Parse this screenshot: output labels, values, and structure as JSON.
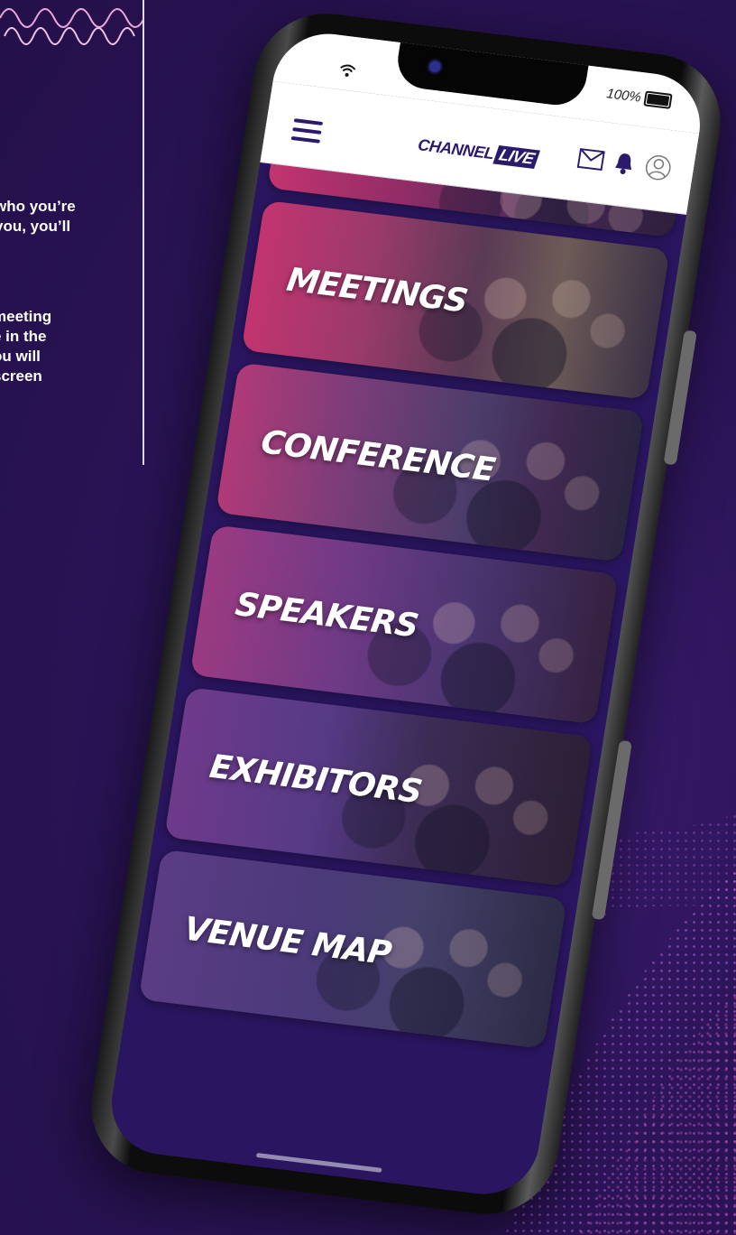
{
  "side_text": {
    "para1_line1": "who you’re",
    "para1_line2": "you, you’ll",
    "para2_line1": "meeting",
    "para2_line2": "e in the",
    "para2_line3": "ou will",
    "para2_line4": "screen"
  },
  "status_bar": {
    "battery_percent": "100%",
    "wifi_icon": "wifi-icon",
    "battery_icon": "battery-icon"
  },
  "app_bar": {
    "logo_channel": "CHANNEL",
    "logo_live": "LIVE",
    "menu_icon": "hamburger-menu-icon",
    "icons": [
      "envelope-icon",
      "bell-icon",
      "user-icon"
    ]
  },
  "tiles": [
    {
      "label": "MEETINGS"
    },
    {
      "label": "CONFERENCE"
    },
    {
      "label": "SPEAKERS"
    },
    {
      "label": "EXHIBITORS"
    },
    {
      "label": "VENUE MAP"
    }
  ],
  "colors": {
    "background": "#2b1457",
    "brand": "#2b1a6b",
    "accent": "#c2346f"
  }
}
